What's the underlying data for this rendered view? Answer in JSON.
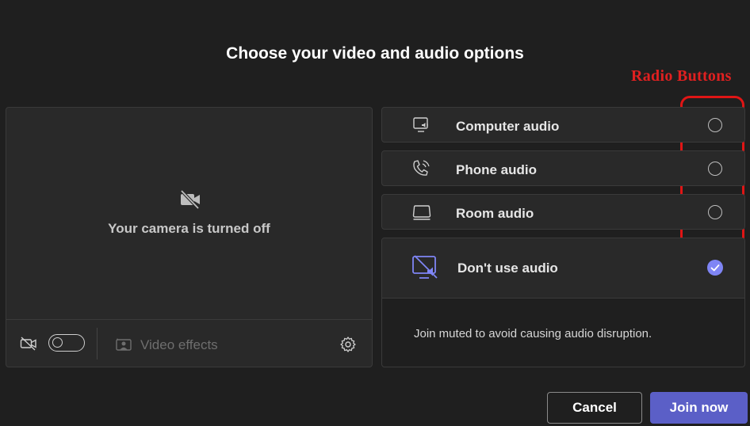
{
  "dialog": {
    "title": "Choose your video and audio options"
  },
  "annotation": {
    "label": "Radio Buttons",
    "color": "#e02020"
  },
  "video": {
    "camera_off_text": "Your camera is turned off",
    "camera_toggle_on": false,
    "effects_label": "Video effects",
    "icons": [
      "camera-off-icon",
      "video-effects-icon",
      "settings-icon"
    ]
  },
  "audio": {
    "options": [
      {
        "label": "Computer audio",
        "icon": "computer-audio-icon",
        "selected": false
      },
      {
        "label": "Phone audio",
        "icon": "phone-audio-icon",
        "selected": false
      },
      {
        "label": "Room audio",
        "icon": "room-audio-icon",
        "selected": false
      },
      {
        "label": "Don't use audio",
        "icon": "no-audio-icon",
        "selected": true
      }
    ],
    "no_audio_description": "Join muted to avoid causing audio disruption."
  },
  "actions": {
    "cancel_label": "Cancel",
    "join_label": "Join now"
  },
  "colors": {
    "accent": "#5b5fc7",
    "check": "#7f85f5",
    "background": "#1f1f1f"
  }
}
